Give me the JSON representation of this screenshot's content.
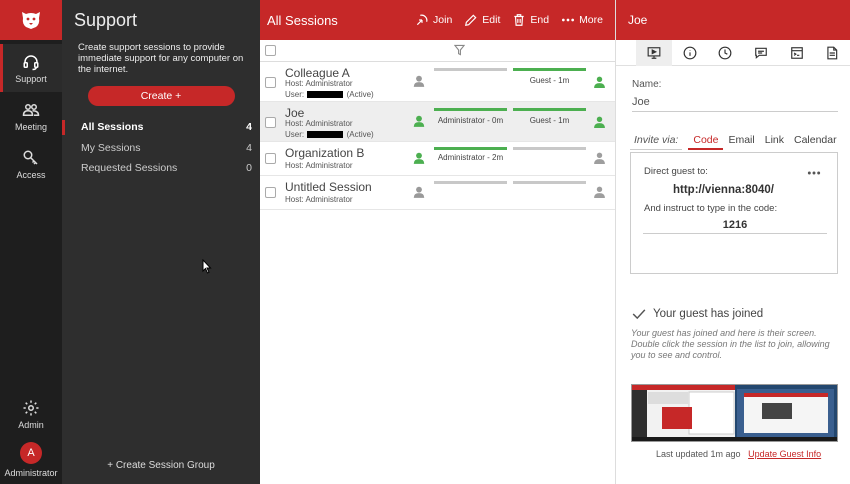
{
  "rail": {
    "items": [
      {
        "label": "Support"
      },
      {
        "label": "Meeting"
      },
      {
        "label": "Access"
      }
    ],
    "admin_label": "Admin",
    "user_initial": "A",
    "user_label": "Administrator"
  },
  "support": {
    "title": "Support",
    "description": "Create support sessions to provide immediate support for any computer on the internet.",
    "create_label": "Create +",
    "groups": [
      {
        "label": "All Sessions",
        "count": "4"
      },
      {
        "label": "My Sessions",
        "count": "4"
      },
      {
        "label": "Requested Sessions",
        "count": "0"
      }
    ],
    "create_group_label": "+ Create Session Group"
  },
  "sessions": {
    "title": "All Sessions",
    "join_label": "Join",
    "edit_label": "Edit",
    "end_label": "End",
    "more_label": "More",
    "rows": [
      {
        "name": "Colleague A",
        "host": "Host: Administrator",
        "user_prefix": "User:",
        "user_suffix": "(Active)",
        "host_bar_label": "",
        "guest_bar_label": "Guest - 1m"
      },
      {
        "name": "Joe",
        "host": "Host: Administrator",
        "user_prefix": "User:",
        "user_suffix": "(Active)",
        "host_bar_label": "Administrator - 0m",
        "guest_bar_label": "Guest - 1m"
      },
      {
        "name": "Organization B",
        "host": "Host: Administrator",
        "host_bar_label": "Administrator - 2m",
        "guest_bar_label": ""
      },
      {
        "name": "Untitled Session",
        "host": "Host: Administrator",
        "host_bar_label": "",
        "guest_bar_label": ""
      }
    ]
  },
  "details": {
    "title": "Joe",
    "name_label": "Name:",
    "name_value": "Joe",
    "invite_via": "Invite via:",
    "invite_tabs": [
      "Code",
      "Email",
      "Link",
      "Calendar"
    ],
    "direct_guest": "Direct guest to:",
    "url": "http://vienna:8040/",
    "instruct": "And instruct to type in the code:",
    "code": "1216",
    "joined_title": "Your guest has joined",
    "joined_desc": "Your guest has joined and here is their screen. Double click the session in the list to join, allowing you to see and control.",
    "last_updated": "Last updated 1m ago",
    "update_link": "Update Guest Info"
  },
  "colors": {
    "accent": "#c62828",
    "active_green": "#4caf50",
    "rail_bg": "#1e1e1e",
    "panel_bg": "#2e2e2e"
  }
}
